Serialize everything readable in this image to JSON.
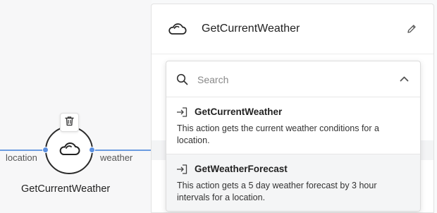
{
  "canvas": {
    "node": {
      "label": "GetCurrentWeather",
      "icon": "cloud-icon",
      "delete_icon": "trash-icon",
      "input_port_label": "location",
      "output_port_label": "weather"
    },
    "wire_color": "#6b9ce0"
  },
  "panel": {
    "title": "GetCurrentWeather",
    "icon": "cloud-icon",
    "edit_icon": "pencil-icon"
  },
  "dropdown": {
    "search": {
      "placeholder": "Search",
      "value": ""
    },
    "options": [
      {
        "title": "GetCurrentWeather",
        "description": "This action gets the current weather conditions for a location."
      },
      {
        "title": "GetWeatherForecast",
        "description": "This action gets a 5 day weather forecast by 3 hour intervals for a location."
      }
    ]
  }
}
